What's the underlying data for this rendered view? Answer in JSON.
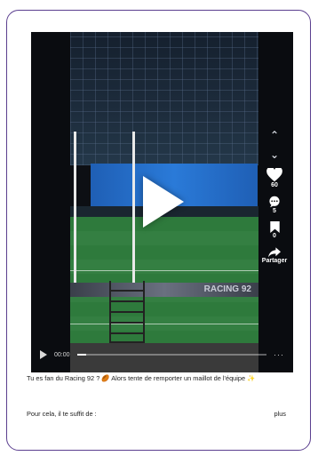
{
  "video": {
    "ad_board_text": "RACING 92",
    "time_label": "00:00",
    "progress_fraction": 0.05,
    "more_label": "···"
  },
  "rail": {
    "likes": "60",
    "comments": "5",
    "saves": "0",
    "share_label": "Partager"
  },
  "caption": {
    "text": "Tu es fan du Racing 92 ? 🏉 Alors tente de remporter un maillot de l'équipe ✨",
    "details": "Pour cela, il te suffit de :",
    "more": "plus"
  },
  "colors": {
    "border": "#5b3f8f",
    "board": "#2a7ad8",
    "pitch": "#2e7a3c"
  },
  "icons": [
    "chevron-up-icon",
    "chevron-down-icon",
    "heart-icon",
    "comment-icon",
    "bookmark-icon",
    "share-icon",
    "play-icon"
  ]
}
